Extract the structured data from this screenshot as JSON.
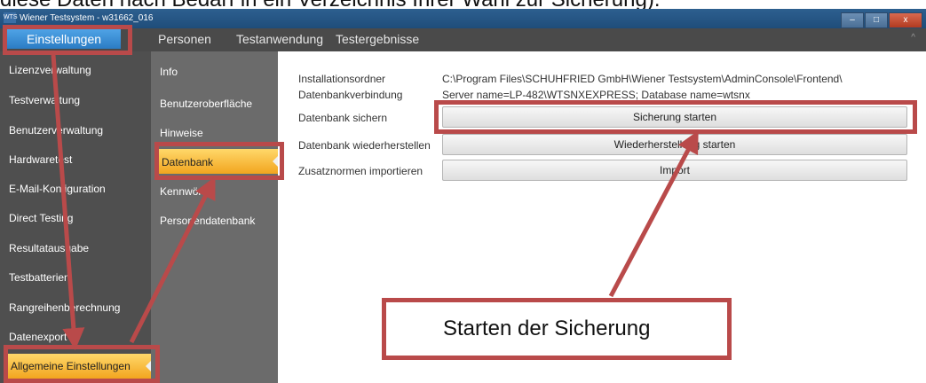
{
  "top_caption": "diese Daten nach Bedarf in ein Verzeichnis Ihrer Wahl zur Sicherung).",
  "window": {
    "title": "Wiener Testsystem - w31662_016",
    "logo_text": "WTS",
    "minimize": "–",
    "maximize": "□",
    "close": "x"
  },
  "menu": {
    "items": [
      "Einstellungen",
      "Personen",
      "Testanwendung",
      "Testergebnisse"
    ],
    "chevron": "^"
  },
  "sidebar1": {
    "items": [
      "Lizenzverwaltung",
      "Testverwaltung",
      "Benutzerverwaltung",
      "Hardwaretest",
      "E-Mail-Konfiguration",
      "Direct Testing",
      "Resultatausgabe",
      "Testbatterien",
      "Rangreihenberechnung",
      "Datenexport"
    ],
    "active": "Allgemeine Einstellungen"
  },
  "sidebar2": {
    "items": [
      "Info",
      "Benutzeroberfläche",
      "Hinweise",
      "Kennwörter",
      "Personendatenbank"
    ],
    "active": "Datenbank"
  },
  "content": {
    "install_label": "Installationsordner",
    "install_value": "C:\\Program Files\\SCHUHFRIED GmbH\\Wiener Testsystem\\AdminConsole\\Frontend\\",
    "db_conn_label": "Datenbankverbindung",
    "db_conn_value": "Server name=LP-482\\WTSNXEXPRESS; Database name=wtsnx",
    "backup_label": "Datenbank sichern",
    "backup_button": "Sicherung starten",
    "restore_label": "Datenbank wiederherstellen",
    "restore_button": "Wiederherstellung starten",
    "import_label": "Zusatznormen importieren",
    "import_button": "Import"
  },
  "annotation": {
    "callout_text": "Starten der Sicherung",
    "color": "#b94a4a"
  },
  "colors": {
    "titlebar": "#1f4d7a",
    "menubar": "#4a4a4a",
    "menu_active": "#2b7cc4",
    "sidebar1": "#4f4f4f",
    "sidebar2": "#6b6b6b",
    "active_item": "#f2a51f"
  }
}
